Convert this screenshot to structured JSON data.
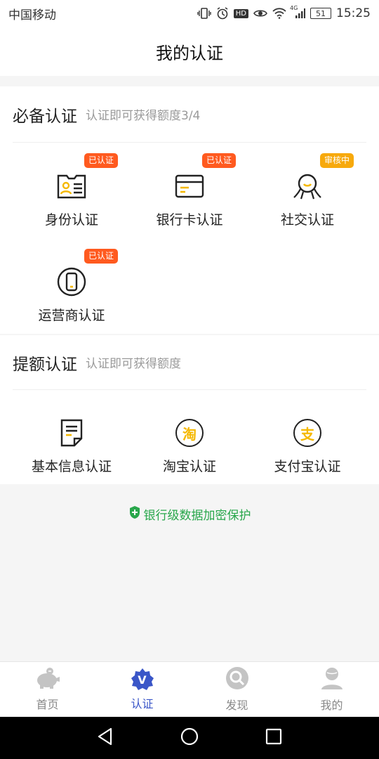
{
  "status_bar": {
    "carrier": "中国移动",
    "network": "4G",
    "hd": "HD",
    "battery": "51",
    "time": "15:25"
  },
  "page_title": "我的认证",
  "required_section": {
    "title": "必备认证",
    "subtitle": "认证即可获得额度3/4",
    "items": [
      {
        "label": "身份认证",
        "icon": "id-card-icon",
        "status": "已认证"
      },
      {
        "label": "银行卡认证",
        "icon": "bank-card-icon",
        "status": "已认证"
      },
      {
        "label": "社交认证",
        "icon": "social-icon",
        "status": "审核中"
      },
      {
        "label": "运营商认证",
        "icon": "phone-carrier-icon",
        "status": "已认证"
      }
    ]
  },
  "extra_section": {
    "title": "提额认证",
    "subtitle": "认证即可获得额度",
    "items": [
      {
        "label": "基本信息认证",
        "icon": "document-icon"
      },
      {
        "label": "淘宝认证",
        "icon": "taobao-icon",
        "glyph": "淘"
      },
      {
        "label": "支付宝认证",
        "icon": "alipay-icon",
        "glyph": "支"
      }
    ]
  },
  "security_note": "银行级数据加密保护",
  "tabs": [
    {
      "label": "首页",
      "icon": "piggy-bank-icon",
      "active": false
    },
    {
      "label": "认证",
      "icon": "verified-icon",
      "glyph": "V",
      "active": true
    },
    {
      "label": "发现",
      "icon": "discover-icon",
      "active": false
    },
    {
      "label": "我的",
      "icon": "profile-icon",
      "active": false
    }
  ],
  "colors": {
    "accent": "#3a56c8",
    "badge_done": "#ff5a1f",
    "badge_review": "#f7a90c",
    "security_green": "#28a74b",
    "icon_yellow": "#f5b800"
  }
}
